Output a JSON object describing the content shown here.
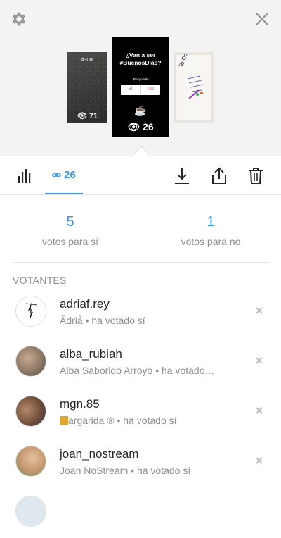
{
  "header": {
    "settings_icon": "gear-icon",
    "close_icon": "close-icon"
  },
  "stories": {
    "left": {
      "tag": "#30ot",
      "views": "71"
    },
    "center": {
      "question_line1": "¿Van a ser",
      "question_line2": "#BuenosDías?",
      "respond": "¡Responde!",
      "option_yes": "SÍ",
      "option_no": "NO",
      "views": "26"
    },
    "right": {
      "text": "To-Do List"
    }
  },
  "toolbar": {
    "views_count": "26",
    "accent": "#3897f0"
  },
  "poll": {
    "yes_count": "5",
    "yes_label": "votos para sí",
    "no_count": "1",
    "no_label": "votos para no"
  },
  "voters_title": "VOTANTES",
  "voters": [
    {
      "username": "adriaf.rey",
      "subtitle": "Ädriå • ha votado sí"
    },
    {
      "username": "alba_rubiah",
      "subtitle": "Alba Saborido Arroyo • ha votado…"
    },
    {
      "username": "mgn.85",
      "subtitle": "argarida ® • ha votado sí"
    },
    {
      "username": "joan_nostream",
      "subtitle": "Joan NoStream • ha votado sí"
    }
  ]
}
